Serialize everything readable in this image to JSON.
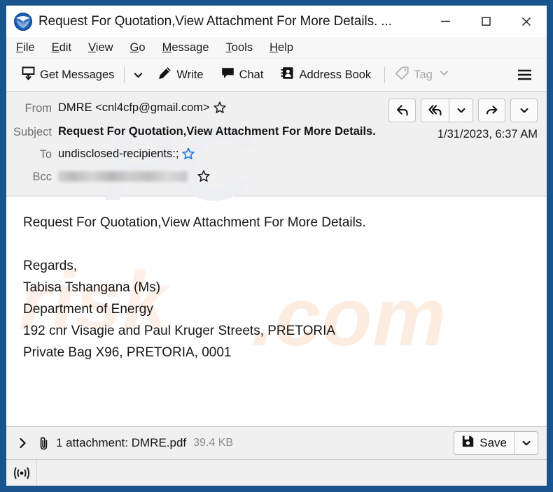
{
  "window": {
    "title": "Request For Quotation,View Attachment For More Details. ...",
    "app_icon": "thunderbird-logo-icon",
    "controls": {
      "minimize": "minimize-icon",
      "maximize": "maximize-icon",
      "close": "close-icon"
    },
    "border_color": "#18548d"
  },
  "menubar": {
    "items": [
      {
        "accel": "F",
        "rest": "ile"
      },
      {
        "accel": "E",
        "rest": "dit"
      },
      {
        "accel": "V",
        "rest": "iew"
      },
      {
        "accel": "G",
        "rest": "o"
      },
      {
        "accel": "M",
        "rest": "essage"
      },
      {
        "accel": "T",
        "rest": "ools"
      },
      {
        "accel": "H",
        "rest": "elp"
      }
    ]
  },
  "toolbar": {
    "get_messages_label": "Get Messages",
    "write_label": "Write",
    "chat_label": "Chat",
    "address_book_label": "Address Book",
    "tag_label": "Tag",
    "tag_disabled": true,
    "menu_icon": "hamburger-menu-icon"
  },
  "message_header": {
    "from_label": "From",
    "from_value": "DMRE <cnl4cfp@gmail.com>",
    "subject_label": "Subject",
    "subject_value": "Request For Quotation,View Attachment For More Details.",
    "to_label": "To",
    "to_value": "undisclosed-recipients:;",
    "bcc_label": "Bcc",
    "bcc_value": "",
    "bcc_redacted": true,
    "date": "1/31/2023, 6:37 AM",
    "star_default_color": "#1a1a1a",
    "star_active_color": "#1a73e8",
    "actions": {
      "reply": "reply-icon",
      "reply_all": "reply-all-icon",
      "reply_menu": "chevron-down-icon",
      "forward": "forward-icon",
      "more_menu": "chevron-down-icon"
    }
  },
  "body": {
    "lines": [
      "Request For Quotation,View Attachment For More Details.",
      "",
      "Regards,",
      "Tabisa Tshangana (Ms)",
      "Department of Energy",
      "192 cnr Visagie and Paul Kruger Streets, PRETORIA",
      "Private Bag X96, PRETORIA, 0001"
    ],
    "watermark": {
      "part1": "PC",
      "part2": "risk",
      "part3": ".com"
    }
  },
  "attachment_bar": {
    "expand_icon": "chevron-right-icon",
    "clip_icon": "paperclip-icon",
    "text": "1 attachment: DMRE.pdf",
    "size": "39.4 KB",
    "save_label": "Save",
    "save_icon": "save-disk-icon",
    "save_menu_icon": "chevron-down-icon"
  },
  "statusbar": {
    "icon": "online-status-broadcast-icon"
  }
}
